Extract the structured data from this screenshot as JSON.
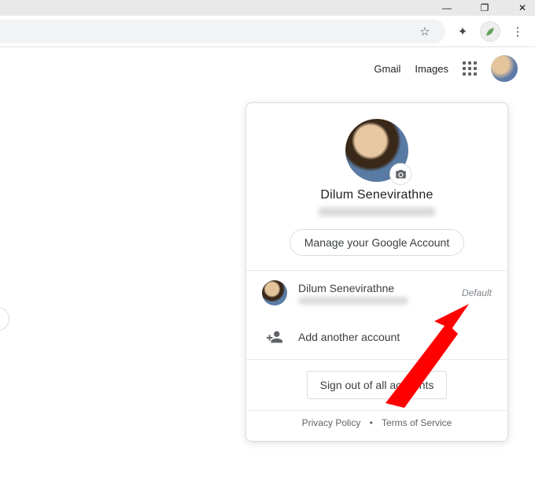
{
  "titlebar": {
    "minimize": "—",
    "maximize": "❐",
    "close": "✕"
  },
  "chromebar": {
    "star": "☆",
    "ext": "✦",
    "menu": "⋮"
  },
  "pagebar": {
    "gmail": "Gmail",
    "images": "Images"
  },
  "popup": {
    "name": "Dilum Senevirathne",
    "manage": "Manage your Google Account",
    "accounts": [
      {
        "name": "Dilum Senevirathne",
        "tag": "Default"
      }
    ],
    "add": "Add another account",
    "signout": "Sign out of all accounts",
    "privacy": "Privacy Policy",
    "terms": "Terms of Service",
    "dot": "•"
  }
}
